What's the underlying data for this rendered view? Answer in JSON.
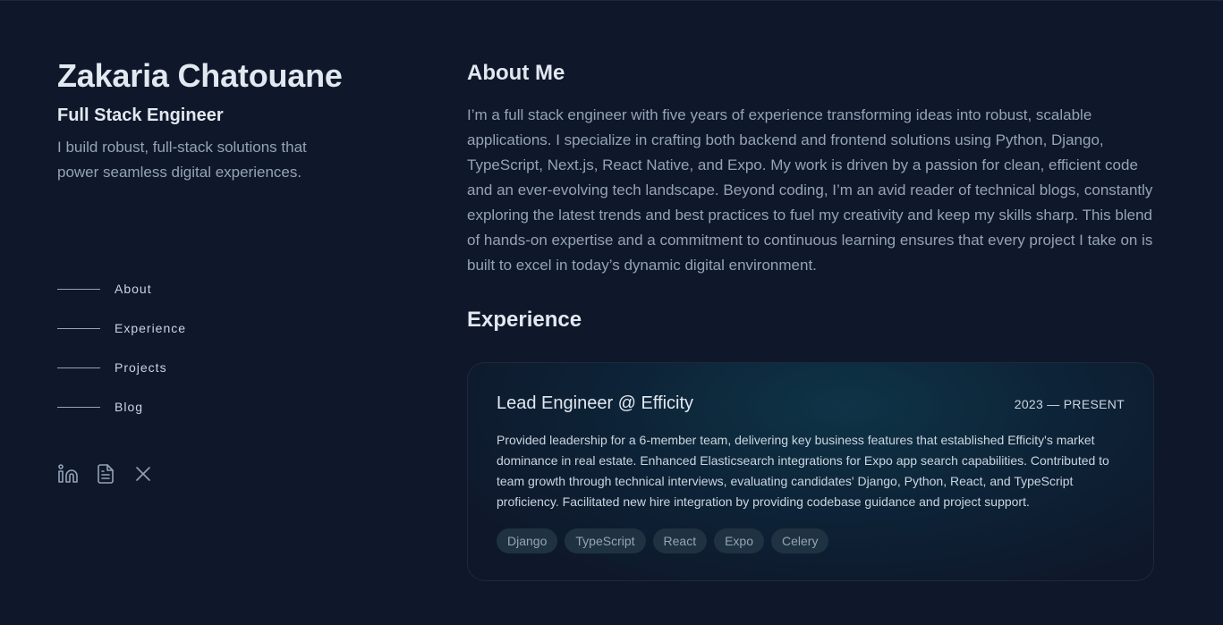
{
  "profile": {
    "name": "Zakaria Chatouane",
    "role": "Full Stack Engineer",
    "tagline": "I build robust, full-stack solutions that power seamless digital experiences."
  },
  "nav": {
    "items": [
      {
        "label": "About"
      },
      {
        "label": "Experience"
      },
      {
        "label": "Projects"
      },
      {
        "label": "Blog"
      }
    ]
  },
  "social": {
    "icons": [
      "linkedin-icon",
      "resume-document-icon",
      "x-icon"
    ]
  },
  "about": {
    "heading": "About Me",
    "text": "I’m a full stack engineer with five years of experience transforming ideas into robust, scalable applications. I specialize in crafting both backend and frontend solutions using Python, Django, TypeScript, Next.js, React Native, and Expo. My work is driven by a passion for clean, efficient code and an ever-evolving tech landscape. Beyond coding, I’m an avid reader of technical blogs, constantly exploring the latest trends and best practices to fuel my creativity and keep my skills sharp. This blend of hands-on expertise and a commitment to continuous learning ensures that every project I take on is built to excel in today’s dynamic digital environment."
  },
  "experience": {
    "heading": "Experience",
    "jobs": [
      {
        "title": "Lead Engineer @ Efficity",
        "date": "2023 — PRESENT",
        "description": "Provided leadership for a 6-member team, delivering key business features that established Efficity's market dominance in real estate. Enhanced Elasticsearch integrations for Expo app search capabilities. Contributed to team growth through technical interviews, evaluating candidates' Django, Python, React, and TypeScript proficiency. Facilitated new hire integration by providing codebase guidance and project support.",
        "tags": [
          "Django",
          "TypeScript",
          "React",
          "Expo",
          "Celery"
        ]
      }
    ]
  },
  "colors": {
    "background": "#0f172a",
    "heading": "#e2e8f0",
    "body": "#94a3b8",
    "tag_bg": "#1e3242"
  }
}
